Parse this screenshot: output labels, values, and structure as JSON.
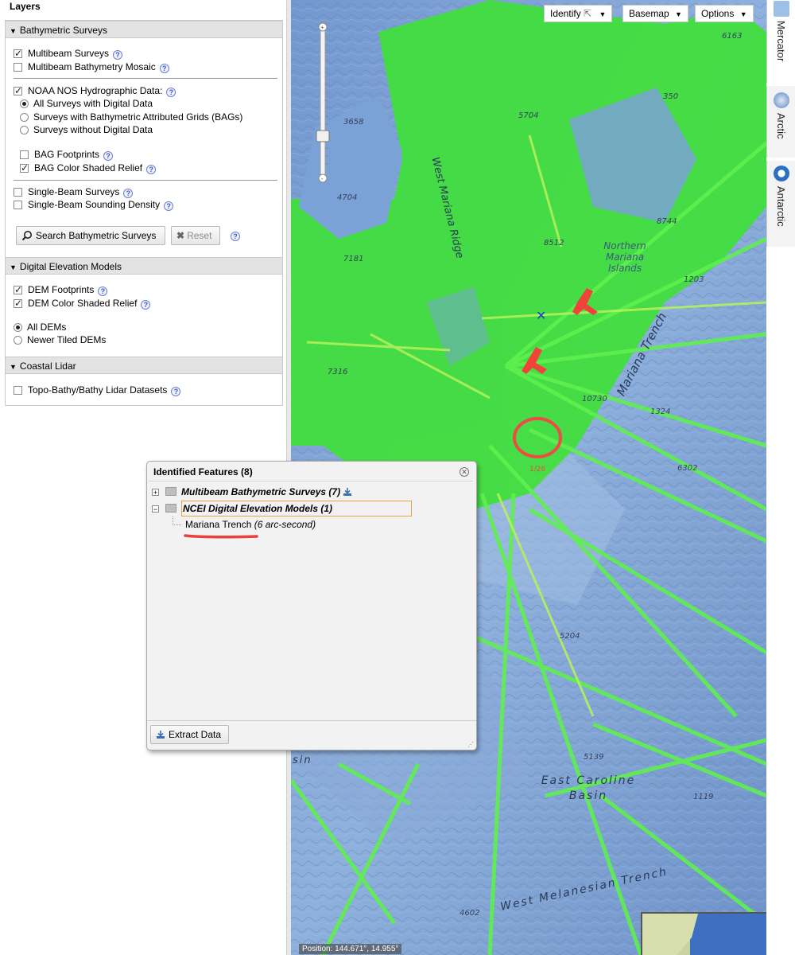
{
  "layers_panel": {
    "title": "Layers",
    "sections": {
      "bathymetric": {
        "title": "Bathymetric Surveys",
        "multibeam_surveys": "Multibeam Surveys",
        "multibeam_mosaic": "Multibeam Bathymetry Mosaic",
        "noaa_nos": "NOAA NOS Hydrographic Data:",
        "radio_all": "All Surveys with Digital Data",
        "radio_bags": "Surveys with Bathymetric Attributed Grids (BAGs)",
        "radio_nodigital": "Surveys without Digital Data",
        "bag_footprints": "BAG Footprints",
        "bag_relief": "BAG Color Shaded Relief",
        "single_beam": "Single-Beam Surveys",
        "single_beam_density": "Single-Beam Sounding Density",
        "search_button": "Search Bathymetric Surveys",
        "reset_button": "Reset"
      },
      "dem": {
        "title": "Digital Elevation Models",
        "footprints": "DEM Footprints",
        "relief": "DEM Color Shaded Relief",
        "radio_all": "All DEMs",
        "radio_newer": "Newer Tiled DEMs"
      },
      "lidar": {
        "title": "Coastal Lidar",
        "datasets": "Topo-Bathy/Bathy Lidar Datasets"
      }
    }
  },
  "map": {
    "toolbar": {
      "identify": "Identify",
      "basemap": "Basemap",
      "options": "Options"
    },
    "labels": {
      "west_mariana_ridge": "West Mariana Ridge",
      "mariana_trench": "Mariana Trench",
      "northern_mariana": "Northern Mariana Islands",
      "east_caroline": "East Caroline Basin",
      "west_melanesian": "West Melanesian Trench",
      "sin": "sin"
    },
    "depths": [
      "6163",
      "350",
      "5704",
      "3658",
      "4704",
      "8744",
      "8512",
      "7181",
      "1203",
      "7316",
      "10730",
      "1324",
      "6302",
      "5204",
      "5139",
      "1119",
      "4602"
    ],
    "position_readout": "Position: 144.671°, 14.955°"
  },
  "projections": {
    "mercator": "Mercator",
    "arctic": "Arctic",
    "antarctic": "Antarctic"
  },
  "identified_dialog": {
    "title": "Identified Features (8)",
    "items": [
      {
        "label": "Multibeam Bathymetric Surveys",
        "count": "(7)"
      },
      {
        "label": "NCEI Digital Elevation Models",
        "count": "(1)"
      }
    ],
    "child": {
      "name": "Mariana Trench",
      "detail": "(6 arc-second)"
    },
    "extract_button": "Extract Data"
  }
}
